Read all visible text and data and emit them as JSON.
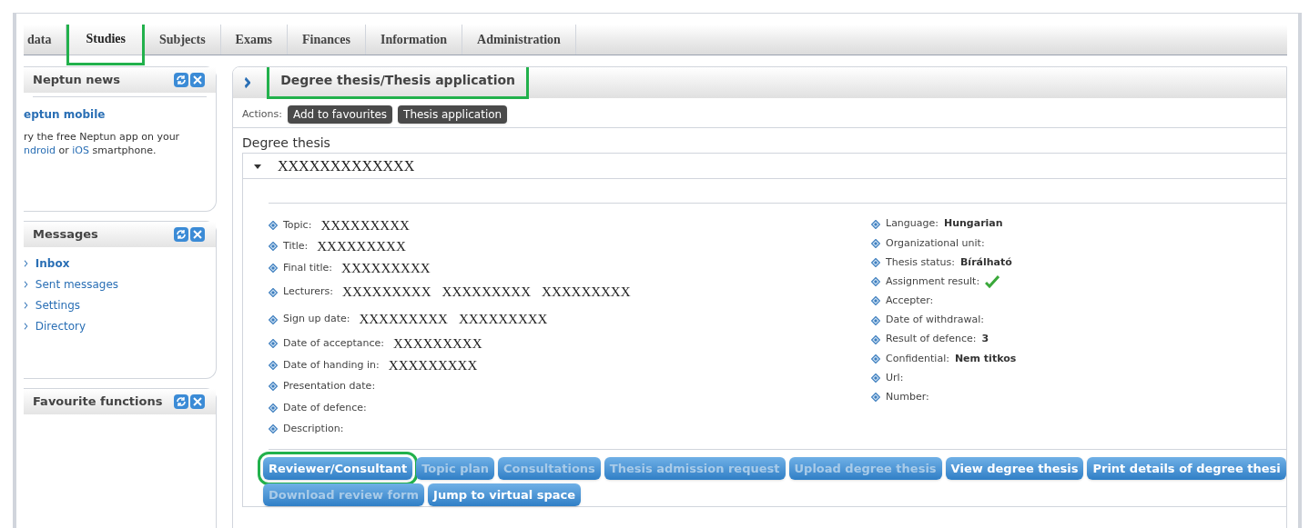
{
  "tabs": [
    {
      "label": "data",
      "selected": false,
      "highlighted": false
    },
    {
      "label": "Studies",
      "selected": true,
      "highlighted": true
    },
    {
      "label": "Subjects",
      "selected": false,
      "highlighted": false
    },
    {
      "label": "Exams",
      "selected": false,
      "highlighted": false
    },
    {
      "label": "Finances",
      "selected": false,
      "highlighted": false
    },
    {
      "label": "Information",
      "selected": false,
      "highlighted": false
    },
    {
      "label": "Administration",
      "selected": false,
      "highlighted": false
    }
  ],
  "sidebar": [
    {
      "title": "Neptun news",
      "kind": "news",
      "link": "eptun mobile",
      "text": "ry the free Neptun app on your **ndroid** or **iOS** smartphone."
    },
    {
      "title": "Messages",
      "kind": "links",
      "items": [
        {
          "label": "Inbox",
          "selected": true
        },
        {
          "label": "Sent messages",
          "selected": false
        },
        {
          "label": "Settings",
          "selected": false
        },
        {
          "label": "Directory",
          "selected": false
        }
      ]
    },
    {
      "title": "Favourite functions",
      "kind": "empty"
    }
  ],
  "page": {
    "title": "Degree thesis/Thesis application",
    "title_highlighted": true,
    "actions_label": "Actions:",
    "actions": [
      "Add to favourites",
      "Thesis application"
    ],
    "section": "Degree thesis",
    "thesis": {
      "name": "XXXXXXXXXXXXX",
      "expanded": true,
      "left_fields": [
        {
          "label": "Topic:",
          "values": [
            "XXXXXXXXX"
          ]
        },
        {
          "label": "Title:",
          "values": [
            "XXXXXXXXX"
          ]
        },
        {
          "label": "Final title:",
          "values": [
            "XXXXXXXXX"
          ]
        },
        {
          "label": "Lecturers:",
          "values": [
            "XXXXXXXXX",
            "XXXXXXXXX",
            "XXXXXXXXX"
          ]
        },
        {
          "label": "Sign up date:",
          "values": [
            "XXXXXXXXX",
            "XXXXXXXXX"
          ]
        },
        {
          "label": "Date of acceptance:",
          "values": [
            "XXXXXXXXX"
          ]
        },
        {
          "label": "Date of handing in:",
          "values": [
            "XXXXXXXXX"
          ]
        },
        {
          "label": "Presentation date:"
        },
        {
          "label": "Date of defence:"
        },
        {
          "label": "Description:"
        }
      ],
      "right_fields": [
        {
          "label": "Language:",
          "kind": "text",
          "value": "Hungarian"
        },
        {
          "label": "Organizational unit:",
          "kind": "text"
        },
        {
          "label": "Thesis status:",
          "kind": "text",
          "value": "Bírálható"
        },
        {
          "label": "Assignment result:",
          "kind": "check",
          "checked": true
        },
        {
          "label": "Accepter:",
          "kind": "text"
        },
        {
          "label": "Date of withdrawal:",
          "kind": "text"
        },
        {
          "label": "Result of defence:",
          "kind": "text",
          "value": "3"
        },
        {
          "label": "Confidential:",
          "kind": "text",
          "value": "Nem titkos"
        },
        {
          "label": "Url:",
          "kind": "text"
        },
        {
          "label": "Number:",
          "kind": "text"
        }
      ]
    },
    "buttons": [
      [
        {
          "label": "Reviewer/Consultant",
          "disabled": false,
          "highlighted": true
        },
        {
          "label": "Topic plan",
          "disabled": true,
          "highlighted": false
        },
        {
          "label": "Consultations",
          "disabled": true,
          "highlighted": false
        },
        {
          "label": "Thesis admission request",
          "disabled": true,
          "highlighted": false
        },
        {
          "label": "Upload degree thesis",
          "disabled": true,
          "highlighted": false
        },
        {
          "label": "View degree thesis",
          "disabled": false,
          "highlighted": false
        },
        {
          "label": "Print details of degree thesi",
          "disabled": false,
          "highlighted": false
        }
      ],
      [
        {
          "label": "Download review form",
          "disabled": true,
          "highlighted": false
        },
        {
          "label": "Jump to virtual space",
          "disabled": false,
          "highlighted": false
        }
      ]
    ]
  }
}
